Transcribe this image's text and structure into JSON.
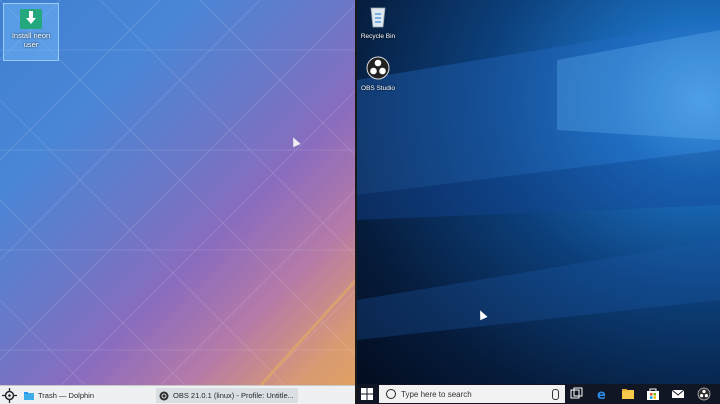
{
  "kde": {
    "desktop_icon": {
      "label": "Install neon user",
      "icon": "download-install-icon"
    },
    "panel": {
      "launcher_icon": "kde-launcher-icon",
      "tasks": [
        {
          "label": "Trash — Dolphin",
          "icon": "dolphin-folder-icon"
        },
        {
          "label": "OBS 21.0.1 (linux) - Profile: Untitle...",
          "icon": "obs-icon"
        }
      ]
    }
  },
  "windows": {
    "desktop_icons": [
      {
        "label": "Recycle Bin",
        "icon": "recycle-bin-icon"
      },
      {
        "label": "OBS Studio",
        "icon": "obs-studio-icon"
      }
    ],
    "taskbar": {
      "search_placeholder": "Type here to search",
      "pinned": [
        "task-view-icon",
        "edge-icon",
        "file-explorer-icon",
        "store-icon",
        "mail-icon",
        "obs-icon"
      ]
    }
  },
  "colors": {
    "kde_accent": "#3daee9",
    "win_taskbar": "#101624",
    "win_accent": "#0078d7"
  }
}
